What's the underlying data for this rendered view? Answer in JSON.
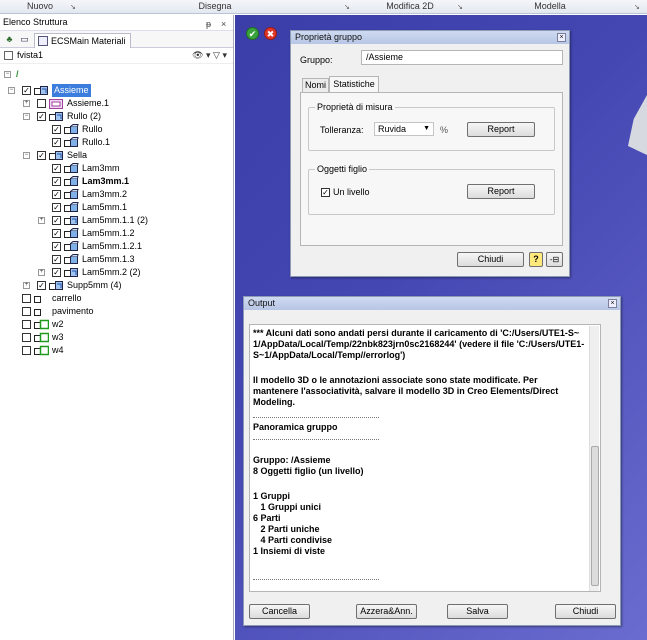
{
  "ribbon": {
    "groups": [
      "Nuovo",
      "Disegna",
      "Modifica 2D",
      "Modella"
    ]
  },
  "tree_panel": {
    "title": "Elenco Struttura",
    "pin": "ᵽ",
    "close": "×",
    "tab_label": "ECSMain Materiali",
    "view_name": "fvista1",
    "tools": "👁 ▾  ▽ ▾"
  },
  "tree": [
    {
      "label": "Assieme",
      "checked": true,
      "exp": "−",
      "selected": true
    },
    {
      "label": "Assieme.1",
      "checked": false,
      "exp": "+"
    },
    {
      "label": "Rullo (2)",
      "checked": true,
      "exp": "−"
    },
    {
      "label": "Rullo",
      "checked": true
    },
    {
      "label": "Rullo.1",
      "checked": true
    },
    {
      "label": "Sella",
      "checked": true,
      "exp": "−"
    },
    {
      "label": "Lam3mm",
      "checked": true
    },
    {
      "label": "Lam3mm.1",
      "checked": true,
      "bold": true
    },
    {
      "label": "Lam3mm.2",
      "checked": true
    },
    {
      "label": "Lam5mm.1",
      "checked": true
    },
    {
      "label": "Lam5mm.1.1 (2)",
      "checked": true,
      "exp": "+"
    },
    {
      "label": "Lam5mm.1.2",
      "checked": true
    },
    {
      "label": "Lam5mm.1.2.1",
      "checked": true
    },
    {
      "label": "Lam5mm.1.3",
      "checked": true
    },
    {
      "label": "Lam5mm.2 (2)",
      "checked": true,
      "exp": "+"
    },
    {
      "label": "Supp5mm (4)",
      "checked": true,
      "exp": "+"
    },
    {
      "label": "carrello",
      "checked": false
    },
    {
      "label": "pavimento",
      "checked": false
    },
    {
      "label": "w2",
      "checked": false
    },
    {
      "label": "w3",
      "checked": false
    },
    {
      "label": "w4",
      "checked": false
    }
  ],
  "group_dialog": {
    "title": "Proprietà gruppo",
    "group_label": "Gruppo:",
    "group_value": "/Assieme",
    "tab_names": "Nomi",
    "tab_stats": "Statistiche",
    "measure_group": "Proprietà di misura",
    "tolerance_label": "Tolleranza:",
    "tolerance_value": "Ruvida",
    "percent": "%",
    "report_btn": "Report",
    "children_group": "Oggetti figlio",
    "one_level_label": "Un livello",
    "one_level_checked": true,
    "report_btn2": "Report",
    "close_btn": "Chiudi",
    "help_icon": "?",
    "pin_icon": "-⊟"
  },
  "output_dialog": {
    "title": "Output",
    "lines": [
      "*** Alcuni dati sono andati persi durante il caricamento di 'C:/Users/UTE1-S~",
      "1/AppData/Local/Temp/22nbk823jrn0sc2168244' (vedere il file 'C:/Users/UTE1-",
      "S~1/AppData/Local/Temp//errorlog')",
      "",
      "Il modello 3D o le annotazioni associate sono state modificate. Per",
      "mantenere l'associatività, salvare il modello 3D in Creo Elements/Direct",
      "Modeling.",
      "",
      "Panoramica gruppo",
      "",
      "",
      "Gruppo: /Assieme",
      "8 Oggetti figlio (un livello)",
      "",
      "1 Gruppi",
      "   1 Gruppi unici",
      "6 Parti",
      "   2 Parti uniche",
      "   4 Parti condivise",
      "1 Insiemi di viste"
    ],
    "cancel_btn": "Cancella",
    "reset_btn": "Azzera&Ann.",
    "save_btn": "Salva",
    "close_btn": "Chiudi"
  },
  "colors": {
    "viewport": "#4446b2",
    "selection": "#3b7ddd",
    "ok": "#39a33b",
    "cancel": "#e0352b"
  }
}
